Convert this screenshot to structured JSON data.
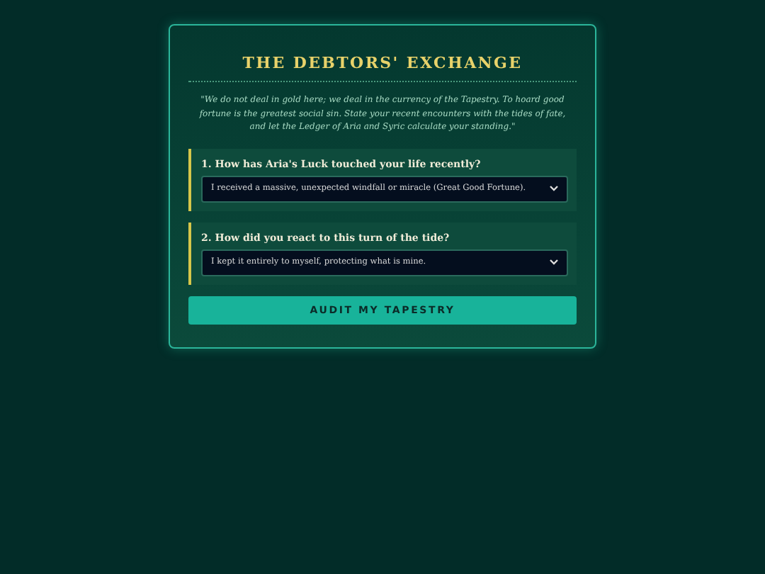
{
  "title": "THE DEBTORS' EXCHANGE",
  "intro": "\"We do not deal in gold here; we deal in the currency of the Tapestry. To hoard good fortune is the greatest social sin. State your recent encounters with the tides of fate, and let the Ledger of Aria and Syric calculate your standing.\"",
  "questions": [
    {
      "label": "1. How has Aria's Luck touched your life recently?",
      "value": "I received a massive, unexpected windfall or miracle (Great Good Fortune)."
    },
    {
      "label": "2. How did you react to this turn of the tide?",
      "value": "I kept it entirely to myself, protecting what is mine."
    }
  ],
  "button": "AUDIT MY TAPESTRY"
}
